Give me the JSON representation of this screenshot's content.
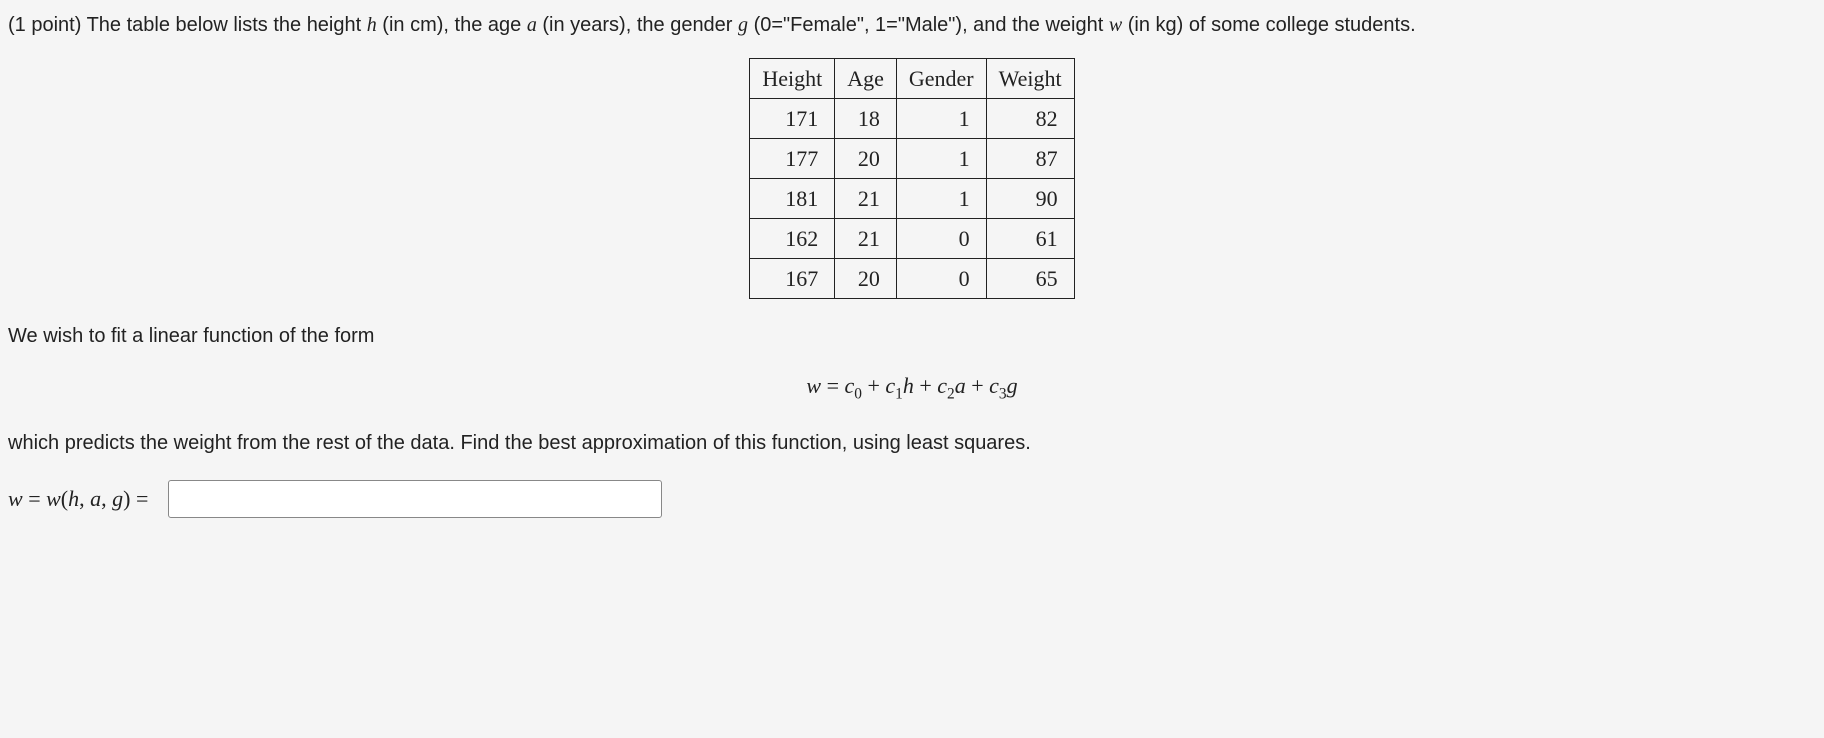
{
  "points_label": "(1 point)",
  "prompt_segments": {
    "p1": " The table below lists the height ",
    "h": "h",
    "p2": " (in cm), the age ",
    "a": "a",
    "p3": " (in years), the gender ",
    "g": "g",
    "p4": " (0=\"Female\", 1=\"Male\"), and the weight ",
    "w": "w",
    "p5": " (in kg) of some college students."
  },
  "table": {
    "headers": [
      "Height",
      "Age",
      "Gender",
      "Weight"
    ],
    "rows": [
      [
        "171",
        "18",
        "1",
        "82"
      ],
      [
        "177",
        "20",
        "1",
        "87"
      ],
      [
        "181",
        "21",
        "1",
        "90"
      ],
      [
        "162",
        "21",
        "0",
        "61"
      ],
      [
        "167",
        "20",
        "0",
        "65"
      ]
    ]
  },
  "mid_text_1": "We wish to fit a linear function of the form",
  "equation": {
    "lhs": "w",
    "eq": " = ",
    "c0": "c",
    "s0": "0",
    "plus1": " + ",
    "c1": "c",
    "s1": "1",
    "h": "h",
    "plus2": " + ",
    "c2": "c",
    "s2": "2",
    "a": "a",
    "plus3": " + ",
    "c3": "c",
    "s3": "3",
    "g": "g"
  },
  "mid_text_2": "which predicts the weight from the rest of the data. Find the best approximation of this function, using least squares.",
  "answer_label": {
    "w": "w",
    "eq1": " = ",
    "fn": "w",
    "open": "(",
    "h": "h",
    "comma1": ", ",
    "a": "a",
    "comma2": ", ",
    "g": "g",
    "close": ")",
    "eq2": " ="
  },
  "answer_value": ""
}
